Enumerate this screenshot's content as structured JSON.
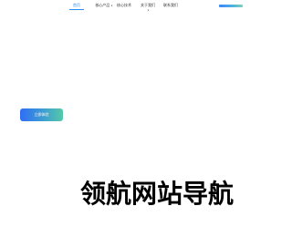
{
  "nav": {
    "items": [
      {
        "label": "首页",
        "active": true
      },
      {
        "label": "核心产品",
        "has_dropdown": true
      },
      {
        "label": "核心技术"
      },
      {
        "label": "关于我们",
        "has_dropdown": true
      },
      {
        "label": "联系我们"
      }
    ],
    "caret": "∨"
  },
  "hero": {
    "cta_label": "立即体验"
  },
  "watermark": {
    "text": "领航网站导航"
  },
  "colors": {
    "accent": "#2d8cf0",
    "cta_gradient_start": "#2f6df6",
    "cta_gradient_end": "#55c9a7"
  }
}
